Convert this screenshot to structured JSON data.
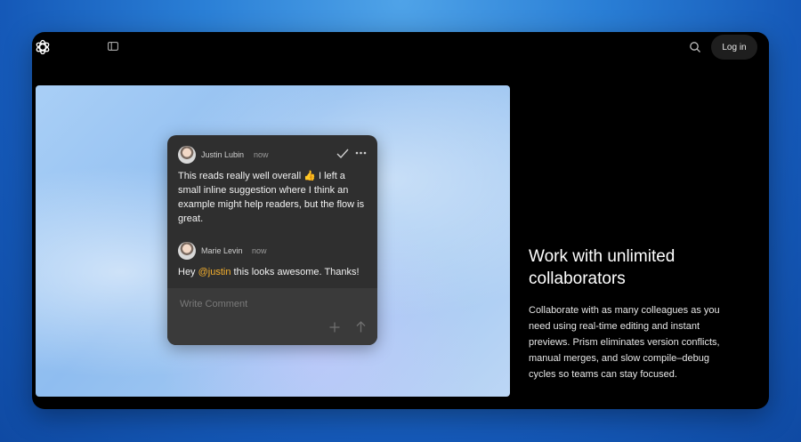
{
  "header": {
    "logo_icon": "openai-logo-icon",
    "sidebar_icon": "sidebar-toggle-icon",
    "search_icon": "search-icon",
    "login_label": "Log in"
  },
  "comment_card": {
    "comments": [
      {
        "author": "Justin Lubin",
        "time": "now",
        "text_before": "This reads really well overall 👍 I left a small inline suggestion where I think an example might help readers, but the flow is great."
      },
      {
        "author": "Marie Levin",
        "time": "now",
        "text_before": "Hey ",
        "mention": "@justin",
        "text_after": " this looks awesome. Thanks!"
      }
    ],
    "resolve_icon": "check-icon",
    "more_icon": "more-horizontal-icon",
    "compose_placeholder": "Write Comment",
    "add_icon": "plus-icon",
    "send_icon": "arrow-up-icon"
  },
  "feature": {
    "title": "Work with unlimited collaborators",
    "description": "Collaborate with as many colleagues as you need using real-time editing and instant previews. Prism eliminates version conflicts, manual merges, and slow compile–debug cycles so teams can stay focused."
  },
  "colors": {
    "mention": "#f5b02e",
    "window_bg": "#000000",
    "card_bg": "#2f2f2f"
  }
}
